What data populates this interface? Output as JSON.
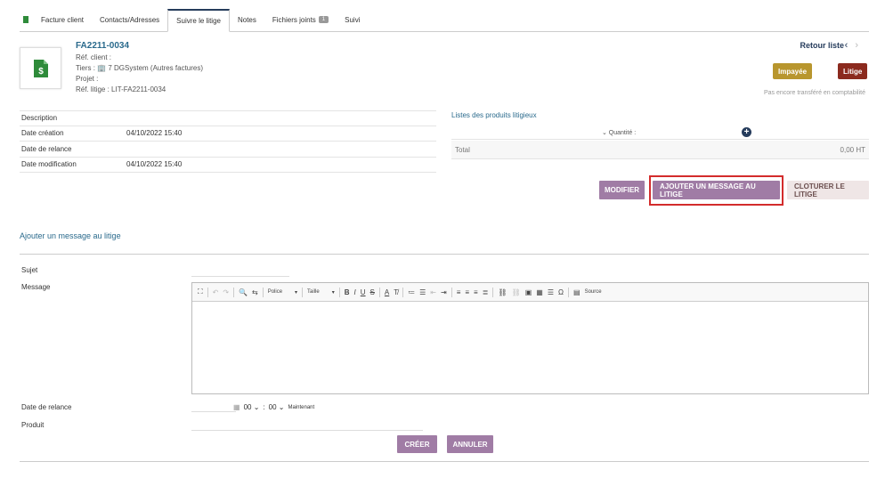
{
  "tabs": [
    {
      "label": "Facture client",
      "active": false
    },
    {
      "label": "Contacts/Adresses",
      "active": false
    },
    {
      "label": "Suivre le litige",
      "active": true
    },
    {
      "label": "Notes",
      "active": false
    },
    {
      "label": "Fichiers joints",
      "active": false,
      "badge": "1"
    },
    {
      "label": "Suivi",
      "active": false
    }
  ],
  "header": {
    "ref": "FA2211-0034",
    "ref_client": "Réf. client :",
    "tiers": "Tiers : 🏢 7 DGSystem (Autres factures)",
    "projet": "Projet :",
    "ref_litige": "Réf. litige : LIT-FA2211-0034",
    "back_label": "Retour liste",
    "status_unpaid": "Impayée",
    "status_litige": "Litige",
    "compta_note": "Pas encore transféré en comptabilité"
  },
  "info": {
    "rows": [
      {
        "label": "Description",
        "value": ""
      },
      {
        "label": "Date création",
        "value": "04/10/2022 15:40"
      },
      {
        "label": "Date de relance",
        "value": ""
      },
      {
        "label": "Date modification",
        "value": "04/10/2022 15:40"
      }
    ]
  },
  "products": {
    "title": "Listes des produits litigieux",
    "qty_label": "⌄ Quantité :",
    "total_label": "Total",
    "total_value": "0,00 HT"
  },
  "actions": {
    "modify": "Modifier",
    "add_message": "Ajouter un message au litige",
    "close": "Cloturer le litige"
  },
  "form": {
    "section_title": "Ajouter un message au litige",
    "subject_label": "Sujet",
    "message_label": "Message",
    "relance_label": "Date de relance",
    "produit_label": "Produit",
    "font_combo": "Police",
    "size_combo": "Taille",
    "source_label": "Source",
    "hour": "00",
    "minute": "00",
    "now_label": "Maintenant",
    "create": "Créer",
    "cancel": "Annuler"
  },
  "colors": {
    "accent_link": "#2a6a8c",
    "button_purple": "#a07ca5",
    "status_unpaid": "#b8962e",
    "status_litige": "#8b2a1e",
    "highlight": "#d32c2c"
  }
}
